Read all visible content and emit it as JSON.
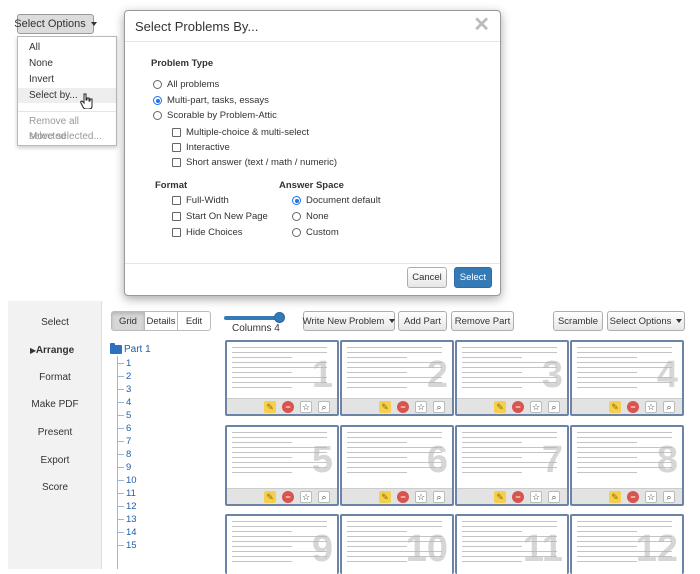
{
  "top_menu": {
    "button_label": "Select Options",
    "items": [
      "All",
      "None",
      "Invert",
      "Select by..."
    ],
    "disabled_items": [
      "Remove all selected",
      "Move selected..."
    ]
  },
  "modal": {
    "title": "Select Problems By...",
    "close_glyph": "✕",
    "problem_type_title": "Problem Type",
    "problem_types": [
      "All problems",
      "Multi-part, tasks, essays",
      "Scorable by Problem-Attic"
    ],
    "selected_problem_type": "Multi-part, tasks, essays",
    "scorable_types": [
      "Multiple-choice & multi-select",
      "Interactive",
      "Short answer (text / math / numeric)"
    ],
    "format_title": "Format",
    "format_options": [
      "Full-Width",
      "Start On New Page",
      "Hide Choices"
    ],
    "answer_space_title": "Answer Space",
    "answer_space_options": [
      "Document default",
      "None",
      "Custom"
    ],
    "selected_answer_space": "Document default",
    "cancel_label": "Cancel",
    "select_label": "Select"
  },
  "sidebar": {
    "items": [
      "Select",
      "Arrange",
      "Format",
      "Make PDF",
      "Present",
      "Export",
      "Score"
    ],
    "active": "Arrange"
  },
  "toolbar": {
    "views": [
      "Grid",
      "Details",
      "Edit"
    ],
    "active_view": "Grid",
    "columns_label": "Columns 4",
    "write_label": "Write New Problem",
    "add_part_label": "Add Part",
    "remove_part_label": "Remove Part",
    "scramble_label": "Scramble",
    "select_options_label": "Select Options"
  },
  "tree": {
    "part_label": "Part 1",
    "items": [
      "1",
      "2",
      "3",
      "4",
      "5",
      "6",
      "7",
      "8",
      "9",
      "10",
      "11",
      "12",
      "13",
      "14",
      "15"
    ]
  },
  "cards": {
    "row1": [
      "1",
      "2",
      "3",
      "4"
    ],
    "row2": [
      "5",
      "6",
      "7",
      "8"
    ],
    "row3": [
      "9",
      "10",
      "11",
      "12"
    ]
  },
  "icons": {
    "pencil": "pencil-icon",
    "remove": "remove-icon",
    "star": "star-icon",
    "zoom": "magnifier-icon"
  },
  "colors": {
    "primary": "#337ab7",
    "card_border": "#6c83a7",
    "tree_link": "#1d5fa8"
  }
}
